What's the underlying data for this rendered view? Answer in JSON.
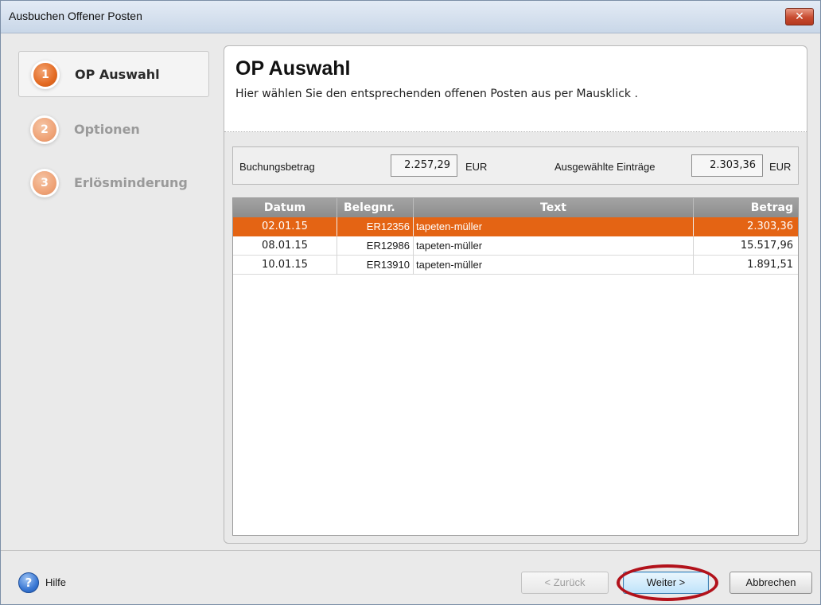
{
  "window": {
    "title": "Ausbuchen Offener Posten",
    "close_glyph": "✕"
  },
  "steps": [
    {
      "num": "1",
      "label": "OP Auswahl",
      "active": true
    },
    {
      "num": "2",
      "label": "Optionen",
      "active": false
    },
    {
      "num": "3",
      "label": "Erlösminderung",
      "active": false
    }
  ],
  "panel": {
    "title": "OP Auswahl",
    "subtitle": "Hier wählen Sie den entsprechenden offenen Posten aus per Mausklick  ."
  },
  "summary": {
    "buchungsbetrag_label": "Buchungsbetrag",
    "buchungsbetrag_value": "2.257,29",
    "buchungsbetrag_unit": "EUR",
    "ausgewaehlt_label": "Ausgewählte Einträge",
    "ausgewaehlt_value": "2.303,36",
    "ausgewaehlt_unit": "EUR"
  },
  "table": {
    "columns": [
      "Datum",
      "Belegnr.",
      "Text",
      "Betrag"
    ],
    "rows": [
      {
        "datum": "02.01.15",
        "beleg": "ER12356",
        "text": "tapeten-müller",
        "betrag": "2.303,36",
        "selected": true
      },
      {
        "datum": "08.01.15",
        "beleg": "ER12986",
        "text": "tapeten-müller",
        "betrag": "15.517,96",
        "selected": false
      },
      {
        "datum": "10.01.15",
        "beleg": "ER13910",
        "text": "tapeten-müller",
        "betrag": "1.891,51",
        "selected": false
      }
    ]
  },
  "footer": {
    "help_glyph": "?",
    "help_label": "Hilfe",
    "back_label": "< Zurück",
    "next_label": "Weiter >",
    "cancel_label": "Abbrechen"
  },
  "colors": {
    "accent": "#e46414",
    "highlight_ring": "#b2121b"
  }
}
